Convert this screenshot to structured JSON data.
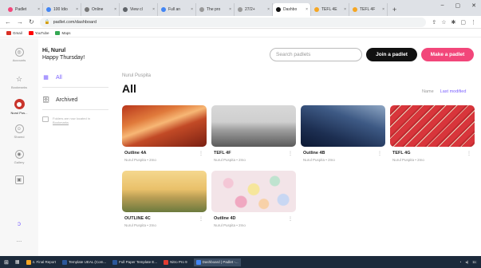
{
  "browser": {
    "tabs": [
      {
        "label": "Padlet",
        "color": "#f2467a"
      },
      {
        "label": "100 Idio",
        "color": "#4285f4"
      },
      {
        "label": "Online",
        "color": "#777777"
      },
      {
        "label": "View cl",
        "color": "#5f6368"
      },
      {
        "label": "Full an",
        "color": "#4285f4"
      },
      {
        "label": "The pro",
        "color": "#999999"
      },
      {
        "label": "27/2+",
        "color": "#999999"
      },
      {
        "label": "Dashbo",
        "color": "#111111"
      },
      {
        "label": "TEFL 4E",
        "color": "#f5a623"
      },
      {
        "label": "TEFL 4F",
        "color": "#f5a623"
      }
    ],
    "active_tab_index": 7,
    "url": "padlet.com/dashboard",
    "bookmarks": [
      {
        "label": "Gmail",
        "color": "#d93025"
      },
      {
        "label": "YouTube",
        "color": "#ff0000"
      },
      {
        "label": "Maps",
        "color": "#34a853"
      }
    ]
  },
  "rail": {
    "items": [
      {
        "label": "Accounts",
        "glyph": "◎"
      },
      {
        "label": "Bookmarks",
        "glyph": "☆"
      },
      {
        "label": "Nurul Pus...",
        "glyph": ""
      },
      {
        "label": "Shared",
        "glyph": "☺"
      },
      {
        "label": "Gallery",
        "glyph": "◉"
      },
      {
        "label": "",
        "glyph": "▣"
      }
    ],
    "more": "..."
  },
  "header": {
    "greeting_name": "Hi, Nurul",
    "greeting_day": "Happy Thursday!",
    "search_placeholder": "Search padlets",
    "join_label": "Join a padlet",
    "make_label": "Make a padlet"
  },
  "filters": {
    "all_label": "All",
    "archived_label": "Archived",
    "folder_note": "Folders are now located in",
    "folder_link": "Bookmarks"
  },
  "main": {
    "owner": "Nurul Puspita",
    "title": "All",
    "sort_name": "Name",
    "sort_modified": "Last modified"
  },
  "padlets": [
    {
      "title": "Outline 4A",
      "sub": "Nurul Puspita • 2mo",
      "art": "canyon"
    },
    {
      "title": "TEFL 4F",
      "sub": "Nurul Puspita • 2mo",
      "art": "desert"
    },
    {
      "title": "Outline 4B",
      "sub": "Nurul Puspita • 2mo",
      "art": "sky"
    },
    {
      "title": "TEFL 4G",
      "sub": "Nurul Puspita • 2mo",
      "art": "pencils"
    },
    {
      "title": "OUTLINE 4C",
      "sub": "Nurul Puspita • 2mo",
      "art": "wind"
    },
    {
      "title": "Outline 4D",
      "sub": "Nurul Puspita • 2mo",
      "art": "candy"
    }
  ],
  "taskbar": {
    "items": [
      {
        "label": "4. Final Report",
        "color": "#f5a623"
      },
      {
        "label": "Template UEAL (Com...",
        "color": "#2b579a"
      },
      {
        "label": "Full Paper Template E...",
        "color": "#2b579a"
      },
      {
        "label": "Nitro Pro 9",
        "color": "#e03c31"
      },
      {
        "label": "Dashboard | Padlet -...",
        "color": "#4285f4"
      }
    ],
    "active_index": 4,
    "clock": "11:"
  }
}
